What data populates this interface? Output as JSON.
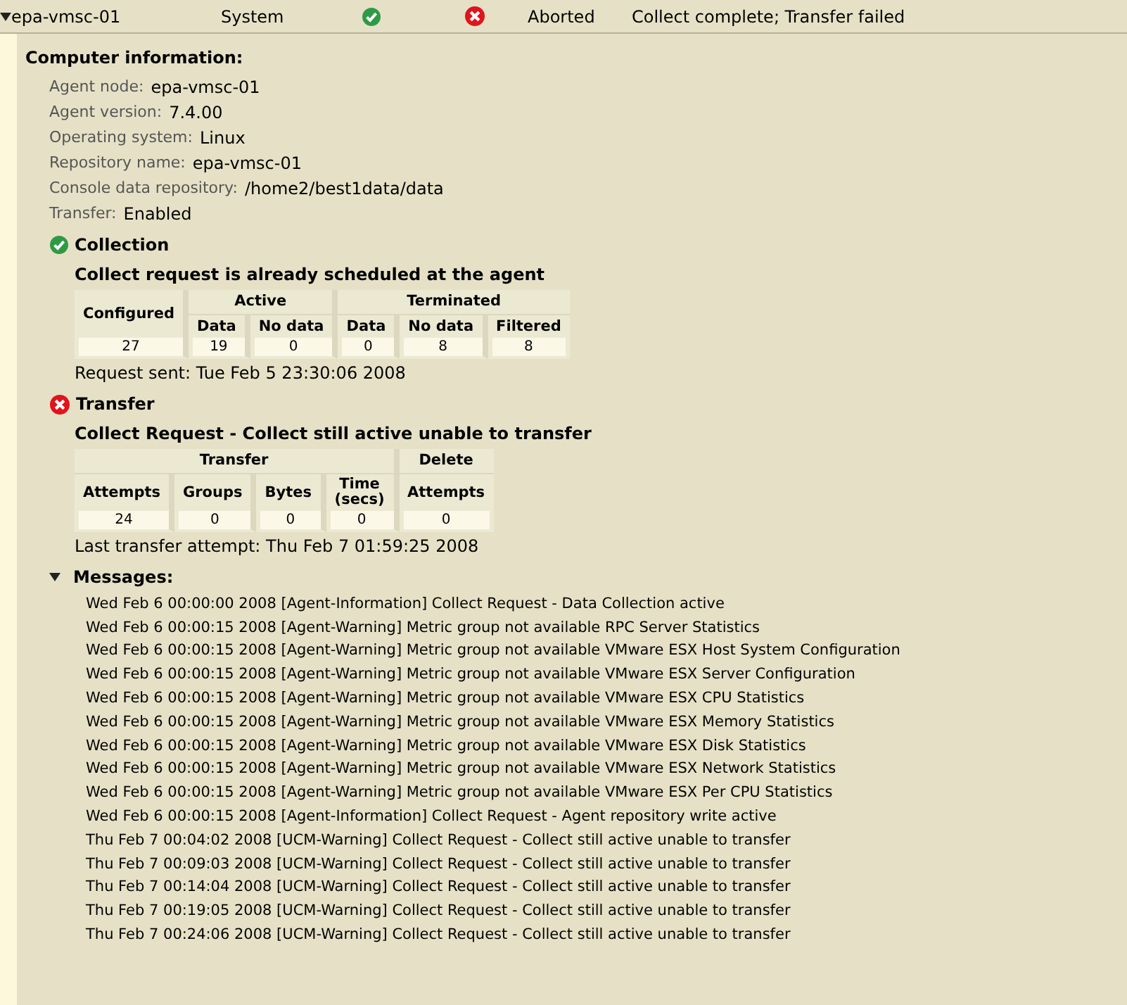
{
  "row": {
    "expanded": true,
    "name": "epa-vmsc-01",
    "type": "System",
    "collection_ok": true,
    "transfer_ok": false,
    "state": "Aborted",
    "detail": "Collect complete; Transfer failed"
  },
  "computer_info": {
    "title": "Computer information:",
    "fields": [
      {
        "label": "Agent node:",
        "value": "epa-vmsc-01"
      },
      {
        "label": "Agent version:",
        "value": "7.4.00"
      },
      {
        "label": "Operating system:",
        "value": "Linux"
      },
      {
        "label": "Repository name:",
        "value": "epa-vmsc-01"
      },
      {
        "label": "Console data repository:",
        "value": "/home2/best1data/data"
      },
      {
        "label": "Transfer:",
        "value": "Enabled"
      }
    ]
  },
  "sections": [
    {
      "title": "Collection",
      "ok": true,
      "subtitle": "Collect request is already scheduled at the agent",
      "groups": [
        {
          "label": "Configured"
        },
        {
          "label": "Active",
          "columns": [
            "Data",
            "No data"
          ]
        },
        {
          "label": "Terminated",
          "columns": [
            "Data",
            "No data",
            "Filtered"
          ]
        }
      ],
      "values": [
        "27",
        "19",
        "0",
        "0",
        "8",
        "8"
      ],
      "footer": "Request sent: Tue Feb 5 23:30:06 2008"
    },
    {
      "title": "Transfer",
      "ok": false,
      "subtitle": "Collect Request - Collect still active unable to transfer",
      "groups": [
        {
          "label": "Transfer",
          "columns": [
            "Attempts",
            "Groups",
            "Bytes",
            "Time (secs)"
          ]
        },
        {
          "label": "Delete",
          "columns": [
            "Attempts"
          ]
        }
      ],
      "values": [
        "24",
        "0",
        "0",
        "0",
        "0"
      ],
      "footer": "Last transfer attempt: Thu Feb 7 01:59:25 2008"
    }
  ],
  "messages": {
    "title": "Messages:",
    "expanded": true,
    "lines": [
      "Wed Feb 6 00:00:00 2008 [Agent-Information] Collect Request - Data Collection active",
      "Wed Feb 6 00:00:15 2008 [Agent-Warning] Metric group not available RPC Server Statistics",
      "Wed Feb 6 00:00:15 2008 [Agent-Warning] Metric group not available VMware ESX Host System Configuration",
      "Wed Feb 6 00:00:15 2008 [Agent-Warning] Metric group not available VMware ESX Server Configuration",
      "Wed Feb 6 00:00:15 2008 [Agent-Warning] Metric group not available VMware ESX CPU Statistics",
      "Wed Feb 6 00:00:15 2008 [Agent-Warning] Metric group not available VMware ESX Memory Statistics",
      "Wed Feb 6 00:00:15 2008 [Agent-Warning] Metric group not available VMware ESX Disk Statistics",
      "Wed Feb 6 00:00:15 2008 [Agent-Warning] Metric group not available VMware ESX Network Statistics",
      "Wed Feb 6 00:00:15 2008 [Agent-Warning] Metric group not available VMware ESX Per CPU Statistics",
      "Wed Feb 6 00:00:15 2008 [Agent-Information] Collect Request - Agent repository write active",
      "Thu Feb 7 00:04:02 2008 [UCM-Warning] Collect Request - Collect still active unable to transfer",
      "Thu Feb 7 00:09:03 2008 [UCM-Warning] Collect Request - Collect still active unable to transfer",
      "Thu Feb 7 00:14:04 2008 [UCM-Warning] Collect Request - Collect still active unable to transfer",
      "Thu Feb 7 00:19:05 2008 [UCM-Warning] Collect Request - Collect still active unable to transfer",
      "Thu Feb 7 00:24:06 2008 [UCM-Warning] Collect Request - Collect still active unable to transfer"
    ]
  }
}
